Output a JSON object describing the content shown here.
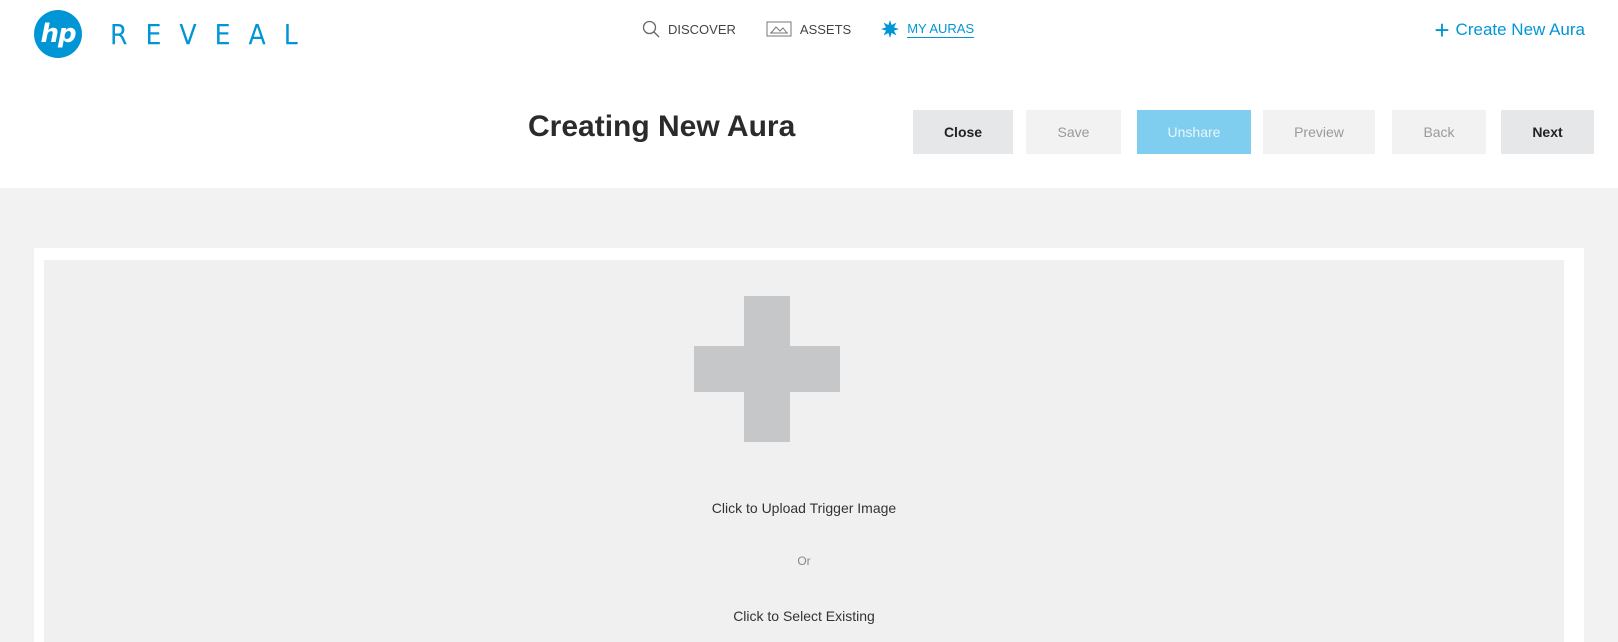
{
  "logo": {
    "mark": "hp",
    "word": "REVEAL"
  },
  "nav": [
    {
      "label": "DISCOVER",
      "icon": "search-icon",
      "active": false
    },
    {
      "label": "ASSETS",
      "icon": "image-icon",
      "active": false
    },
    {
      "label": "MY AURAS",
      "icon": "aura-burst-icon",
      "active": true
    }
  ],
  "create": {
    "plus": "+",
    "label": "Create New Aura"
  },
  "header": {
    "title": "Creating New Aura",
    "buttons": {
      "close": "Close",
      "save": "Save",
      "unshare": "Unshare",
      "preview": "Preview",
      "back": "Back",
      "next": "Next"
    }
  },
  "upload": {
    "primary": "Click to Upload Trigger Image",
    "or": "Or",
    "existing": "Click to Select Existing"
  },
  "colors": {
    "brand": "#0096d6",
    "unshare_bg": "#7fcdef",
    "workspace_bg": "#f2f2f2",
    "plus_gray": "#c5c7c9"
  }
}
